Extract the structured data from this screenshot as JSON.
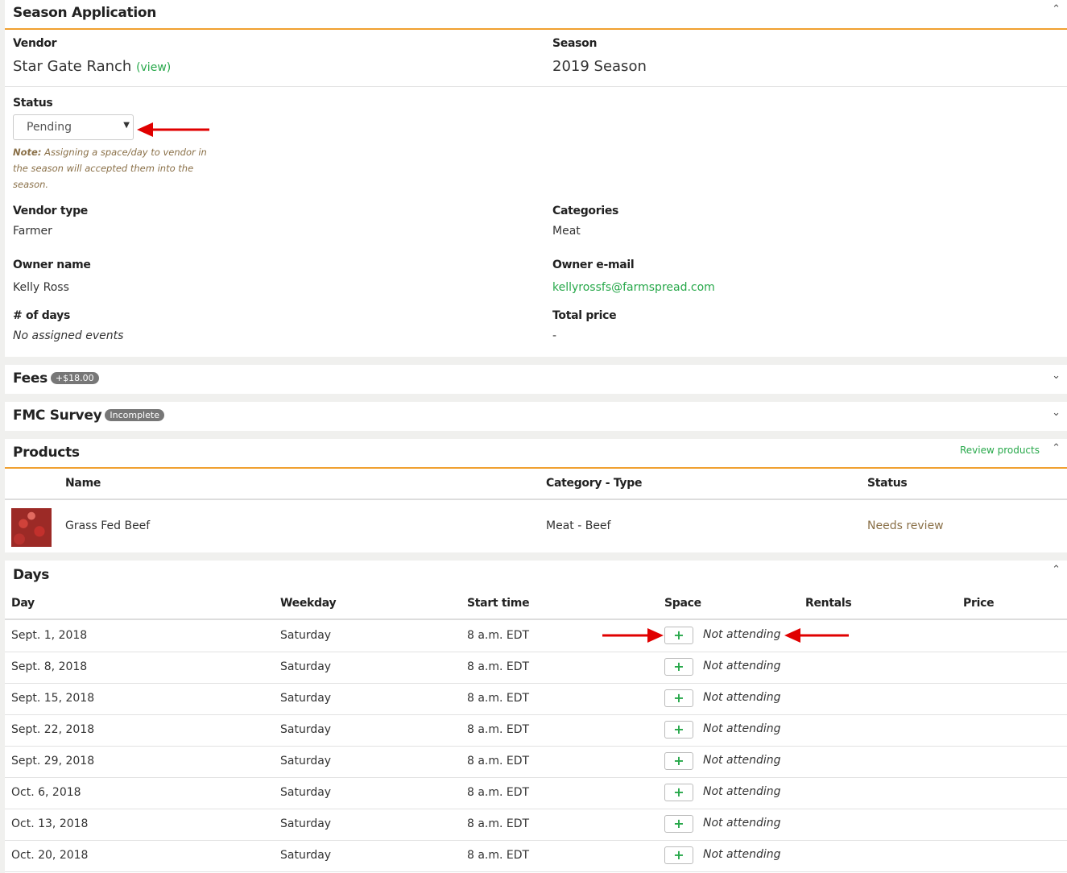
{
  "season_application": {
    "title": "Season Application",
    "vendor_label": "Vendor",
    "vendor_name": "Star Gate Ranch",
    "vendor_view_link": "(view)",
    "season_label": "Season",
    "season_value": "2019 Season",
    "status_label": "Status",
    "status_value": "Pending",
    "note_prefix": "Note:",
    "note_text": " Assigning a space/day to vendor in the season will accepted them into the season.",
    "vendor_type_label": "Vendor type",
    "vendor_type_value": "Farmer",
    "categories_label": "Categories",
    "categories_value": "Meat",
    "owner_name_label": "Owner name",
    "owner_name_value": "Kelly Ross",
    "owner_email_label": "Owner e-mail",
    "owner_email_value": "kellyrossfs@farmspread.com",
    "days_count_label": "# of days",
    "days_count_value": "No assigned events",
    "total_price_label": "Total price",
    "total_price_value": "-"
  },
  "fees": {
    "title": "Fees",
    "badge": "+$18.00"
  },
  "fmc_survey": {
    "title": "FMC Survey",
    "badge": "Incomplete"
  },
  "products": {
    "title": "Products",
    "review_link": "Review products",
    "columns": [
      "Name",
      "Category - Type",
      "Status"
    ],
    "rows": [
      {
        "name": "Grass Fed Beef",
        "category_type": "Meat - Beef",
        "status": "Needs review"
      }
    ]
  },
  "days": {
    "title": "Days",
    "columns": [
      "Day",
      "Weekday",
      "Start time",
      "Space",
      "Rentals",
      "Price"
    ],
    "add_symbol": "+",
    "rows": [
      {
        "day": "Sept. 1, 2018",
        "weekday": "Saturday",
        "start": "8 a.m. EDT",
        "space": "Not attending"
      },
      {
        "day": "Sept. 8, 2018",
        "weekday": "Saturday",
        "start": "8 a.m. EDT",
        "space": "Not attending"
      },
      {
        "day": "Sept. 15, 2018",
        "weekday": "Saturday",
        "start": "8 a.m. EDT",
        "space": "Not attending"
      },
      {
        "day": "Sept. 22, 2018",
        "weekday": "Saturday",
        "start": "8 a.m. EDT",
        "space": "Not attending"
      },
      {
        "day": "Sept. 29, 2018",
        "weekday": "Saturday",
        "start": "8 a.m. EDT",
        "space": "Not attending"
      },
      {
        "day": "Oct. 6, 2018",
        "weekday": "Saturday",
        "start": "8 a.m. EDT",
        "space": "Not attending"
      },
      {
        "day": "Oct. 13, 2018",
        "weekday": "Saturday",
        "start": "8 a.m. EDT",
        "space": "Not attending"
      },
      {
        "day": "Oct. 20, 2018",
        "weekday": "Saturday",
        "start": "8 a.m. EDT",
        "space": "Not attending"
      }
    ]
  },
  "colors": {
    "accent_orange": "#f0a030",
    "link_green": "#27a84a",
    "annotation_red": "#e00000",
    "note_brown": "#8a7048"
  },
  "icons": {
    "collapse": "chevron-up-icon",
    "expand": "chevron-down-icon",
    "add": "plus-icon",
    "annotation": "red-arrow"
  }
}
